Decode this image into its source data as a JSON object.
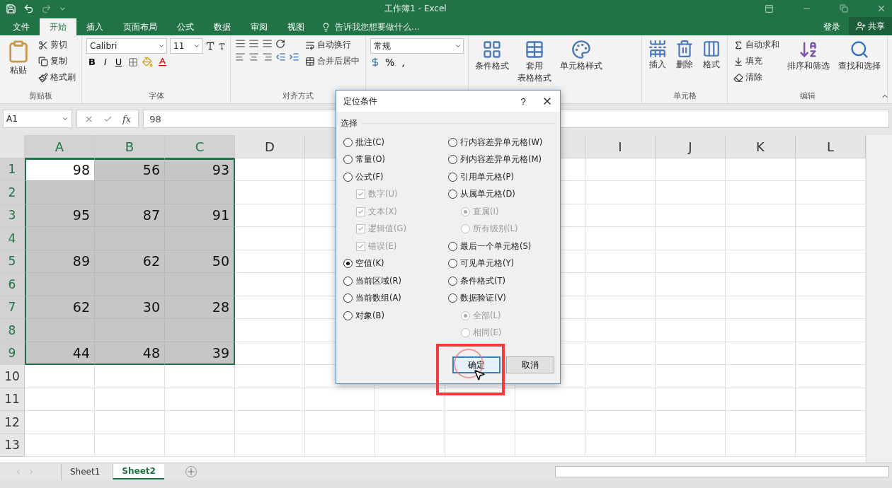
{
  "window": {
    "title": "工作簿1 - Excel"
  },
  "tabs": [
    {
      "label": "文件",
      "selected": false
    },
    {
      "label": "开始",
      "selected": true
    },
    {
      "label": "插入",
      "selected": false
    },
    {
      "label": "页面布局",
      "selected": false
    },
    {
      "label": "公式",
      "selected": false
    },
    {
      "label": "数据",
      "selected": false
    },
    {
      "label": "审阅",
      "selected": false
    },
    {
      "label": "视图",
      "selected": false
    }
  ],
  "tell_me": {
    "placeholder": "告诉我您想要做什么..."
  },
  "account": {
    "sign_in": "登录",
    "share": "共享"
  },
  "ribbon": {
    "groups": [
      {
        "kind": "clipboard",
        "label": "剪贴板",
        "big": "粘贴",
        "items": [
          "剪切",
          "复制",
          "格式刷"
        ]
      },
      {
        "kind": "font",
        "label": "字体",
        "font": "Calibri",
        "size": "11",
        "styles": [
          "B",
          "I",
          "U"
        ]
      },
      {
        "kind": "align",
        "label": "对齐方式",
        "items": [
          "自动换行",
          "合并后居中"
        ]
      },
      {
        "kind": "number",
        "format": "常规",
        "symbols": [
          "%",
          ","
        ]
      },
      {
        "kind": "styles",
        "items": [
          [
            "条件格式"
          ],
          [
            "套用",
            "表格格式"
          ],
          [
            "单元格样式"
          ]
        ]
      },
      {
        "kind": "cells",
        "label": "单元格",
        "items": [
          "插入",
          "删除",
          "格式"
        ]
      },
      {
        "kind": "editing",
        "label": "编辑",
        "small": [
          "自动求和",
          "填充",
          "清除"
        ],
        "items": [
          "排序和筛选",
          "查找和选择"
        ]
      }
    ]
  },
  "formula_bar": {
    "name_box": "A1",
    "function_label": "fx",
    "value": "98"
  },
  "columns": [
    {
      "label": "A",
      "selected": true
    },
    {
      "label": "B",
      "selected": true
    },
    {
      "label": "C",
      "selected": true
    },
    {
      "label": "D",
      "selected": false
    },
    {
      "label": "I",
      "selected": false
    },
    {
      "label": "J",
      "selected": false
    },
    {
      "label": "K",
      "selected": false
    },
    {
      "label": "L",
      "selected": false
    }
  ],
  "rows": [
    {
      "label": "1",
      "selected": true,
      "cells": [
        {
          "value": "98",
          "active": true
        },
        {
          "value": "56",
          "active": false
        },
        {
          "value": "93",
          "active": false
        }
      ]
    },
    {
      "label": "2",
      "selected": true,
      "cells": []
    },
    {
      "label": "3",
      "selected": true,
      "cells": [
        {
          "value": "95",
          "active": false
        },
        {
          "value": "87",
          "active": false
        },
        {
          "value": "91",
          "active": false
        }
      ]
    },
    {
      "label": "4",
      "selected": true,
      "cells": []
    },
    {
      "label": "5",
      "selected": true,
      "cells": [
        {
          "value": "89",
          "active": false
        },
        {
          "value": "62",
          "active": false
        },
        {
          "value": "50",
          "active": false
        }
      ]
    },
    {
      "label": "6",
      "selected": true,
      "cells": []
    },
    {
      "label": "7",
      "selected": true,
      "cells": [
        {
          "value": "62",
          "active": false
        },
        {
          "value": "30",
          "active": false
        },
        {
          "value": "28",
          "active": false
        }
      ]
    },
    {
      "label": "8",
      "selected": true,
      "cells": []
    },
    {
      "label": "9",
      "selected": true,
      "cells": [
        {
          "value": "44",
          "active": false
        },
        {
          "value": "48",
          "active": false
        },
        {
          "value": "39",
          "active": false
        }
      ]
    },
    {
      "label": "10",
      "selected": false,
      "cells": []
    },
    {
      "label": "11",
      "selected": false,
      "cells": []
    },
    {
      "label": "12",
      "selected": false,
      "cells": []
    },
    {
      "label": "13",
      "selected": false,
      "cells": []
    }
  ],
  "sheets": [
    {
      "label": "Sheet1",
      "selected": false
    },
    {
      "label": "Sheet2",
      "selected": true
    }
  ],
  "dialog": {
    "title": "定位条件",
    "help": "?",
    "section": "选择",
    "left": [
      {
        "kind": "radio",
        "label": "批注(C)",
        "selected": false,
        "disabled": false
      },
      {
        "kind": "radio",
        "label": "常量(O)",
        "selected": false,
        "disabled": false
      },
      {
        "kind": "radio",
        "label": "公式(F)",
        "selected": false,
        "disabled": false,
        "children": [
          {
            "kind": "checkbox",
            "label": "数字(U)",
            "checked": true,
            "disabled": true
          },
          {
            "kind": "checkbox",
            "label": "文本(X)",
            "checked": true,
            "disabled": true
          },
          {
            "kind": "checkbox",
            "label": "逻辑值(G)",
            "checked": true,
            "disabled": true
          },
          {
            "kind": "checkbox",
            "label": "错误(E)",
            "checked": true,
            "disabled": true
          }
        ]
      },
      {
        "kind": "radio",
        "label": "空值(K)",
        "selected": true,
        "disabled": false
      },
      {
        "kind": "radio",
        "label": "当前区域(R)",
        "selected": false,
        "disabled": false
      },
      {
        "kind": "radio",
        "label": "当前数组(A)",
        "selected": false,
        "disabled": false
      },
      {
        "kind": "radio",
        "label": "对象(B)",
        "selected": false,
        "disabled": false
      }
    ],
    "right": [
      {
        "kind": "radio",
        "label": "行内容差异单元格(W)",
        "selected": false,
        "disabled": false
      },
      {
        "kind": "radio",
        "label": "列内容差异单元格(M)",
        "selected": false,
        "disabled": false
      },
      {
        "kind": "radio",
        "label": "引用单元格(P)",
        "selected": false,
        "disabled": false
      },
      {
        "kind": "radio",
        "label": "从属单元格(D)",
        "selected": false,
        "disabled": false,
        "children": [
          {
            "kind": "radio",
            "label": "直属(I)",
            "selected": true,
            "disabled": true
          },
          {
            "kind": "radio",
            "label": "所有级别(L)",
            "selected": false,
            "disabled": true
          }
        ]
      },
      {
        "kind": "radio",
        "label": "最后一个单元格(S)",
        "selected": false,
        "disabled": false
      },
      {
        "kind": "radio",
        "label": "可见单元格(Y)",
        "selected": false,
        "disabled": false
      },
      {
        "kind": "radio",
        "label": "条件格式(T)",
        "selected": false,
        "disabled": false
      },
      {
        "kind": "radio",
        "label": "数据验证(V)",
        "selected": false,
        "disabled": false,
        "children": [
          {
            "kind": "radio",
            "label": "全部(L)",
            "selected": true,
            "disabled": true
          },
          {
            "kind": "radio",
            "label": "相同(E)",
            "selected": false,
            "disabled": true
          }
        ]
      }
    ],
    "buttons": [
      {
        "label": "确定",
        "focused": true
      },
      {
        "label": "取消",
        "focused": false
      }
    ]
  }
}
